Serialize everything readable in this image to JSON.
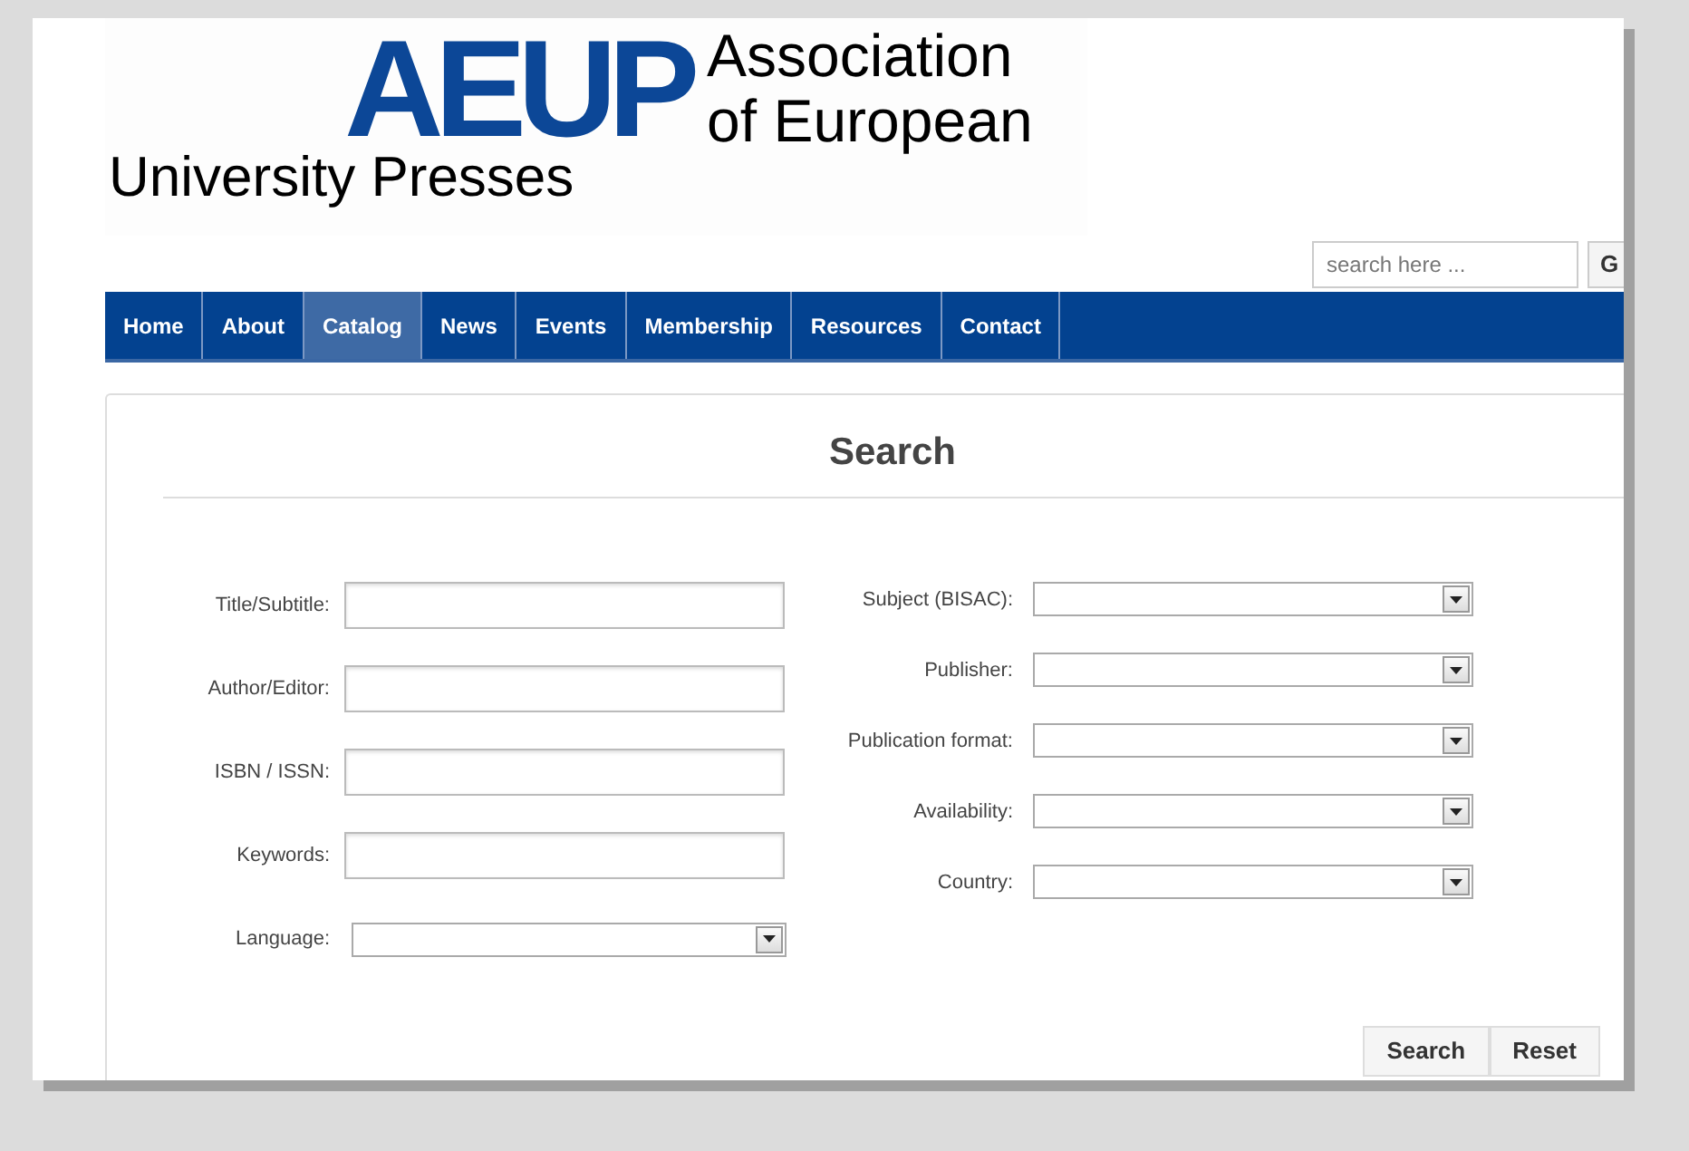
{
  "logo": {
    "mark": "AEUP",
    "line_1": "Association",
    "line_2": "of European",
    "line_3": "University Presses"
  },
  "site_search": {
    "placeholder": "search here ...",
    "button": "G"
  },
  "nav": [
    {
      "label": "Home",
      "selected": false
    },
    {
      "label": "About",
      "selected": false
    },
    {
      "label": "Catalog",
      "selected": true
    },
    {
      "label": "News",
      "selected": false
    },
    {
      "label": "Events",
      "selected": false
    },
    {
      "label": "Membership",
      "selected": false
    },
    {
      "label": "Resources",
      "selected": false
    },
    {
      "label": "Contact",
      "selected": false
    }
  ],
  "form": {
    "title": "Search",
    "left_fields": [
      {
        "label": "Title/Subtitle:",
        "kind": "text"
      },
      {
        "label": "Author/Editor:",
        "kind": "text"
      },
      {
        "label": "ISBN / ISSN:",
        "kind": "text"
      },
      {
        "label": "Keywords:",
        "kind": "text"
      },
      {
        "label": "Language:",
        "kind": "select"
      }
    ],
    "right_fields": [
      {
        "label": "Subject (BISAC):",
        "kind": "select"
      },
      {
        "label": "Publisher:",
        "kind": "select"
      },
      {
        "label": "Publication format:",
        "kind": "select"
      },
      {
        "label": "Availability:",
        "kind": "select"
      },
      {
        "label": "Country:",
        "kind": "select"
      }
    ],
    "buttons": [
      "Search",
      "Reset"
    ]
  }
}
